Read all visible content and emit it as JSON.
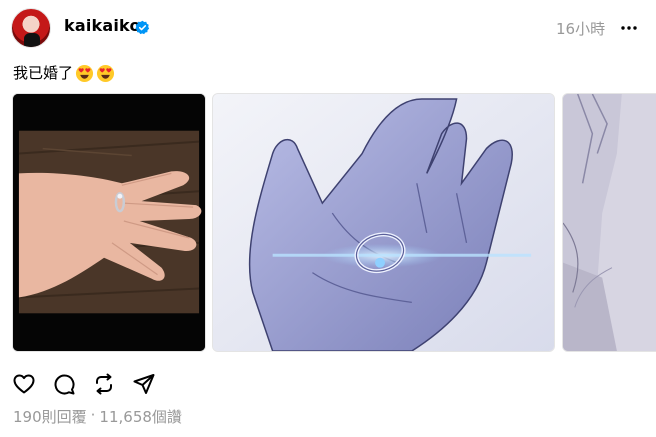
{
  "post": {
    "username": "kaikaiko",
    "timestamp": "16小時",
    "caption": "我已婚了",
    "replies": "190則回覆",
    "separator": "·",
    "views": "11,658個讚"
  },
  "icons": {
    "verified": "verified-badge-icon",
    "more": "more-options-icon",
    "emoji": "heart-eyes-emoji",
    "like": "heart-icon",
    "reply": "comment-icon",
    "repost": "repost-icon",
    "share": "send-icon"
  },
  "colors": {
    "verified_blue": "#0095f6",
    "muted_text": "#999999"
  }
}
